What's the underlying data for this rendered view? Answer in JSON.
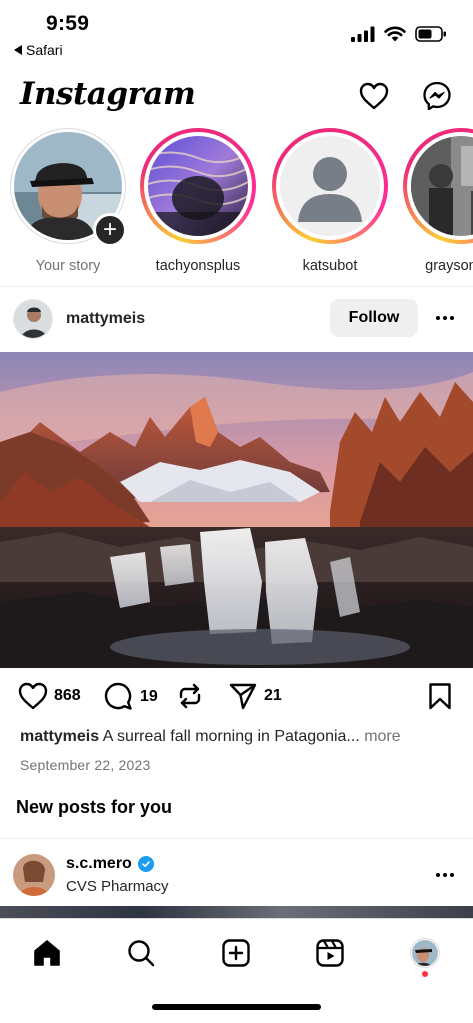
{
  "status_bar": {
    "time": "9:59",
    "back_app": "Safari",
    "icons": [
      "cellular-signal-icon",
      "wifi-icon",
      "battery-icon"
    ]
  },
  "header": {
    "logo": "Instagram",
    "icons": [
      "heart-icon",
      "messenger-icon"
    ]
  },
  "stories": [
    {
      "name": "Your story",
      "own": true
    },
    {
      "name": "tachyonsplus",
      "own": false
    },
    {
      "name": "katsubot",
      "own": false
    },
    {
      "name": "graysonma",
      "own": false
    }
  ],
  "post": {
    "username": "mattymeis",
    "follow_label": "Follow",
    "likes": "868",
    "comments": "19",
    "shares": "21",
    "caption_user": "mattymeis",
    "caption_text": "A surreal fall morning in Patagonia...",
    "caption_more": "more",
    "date": "September 22, 2023"
  },
  "section_title": "New posts for you",
  "suggested": {
    "username": "s.c.mero",
    "subtitle": "CVS Pharmacy",
    "verified": true
  },
  "tabbar": {
    "tabs": [
      "home-icon",
      "search-icon",
      "create-icon",
      "reels-icon",
      "profile-avatar"
    ],
    "active": "home-icon"
  },
  "colors": {
    "story_gradient_start": "#f9ce34",
    "story_gradient_end": "#ee2a7b",
    "verified_blue": "#1d9bf0",
    "notification_red": "#ff3040",
    "follow_button_bg": "#efefef"
  }
}
